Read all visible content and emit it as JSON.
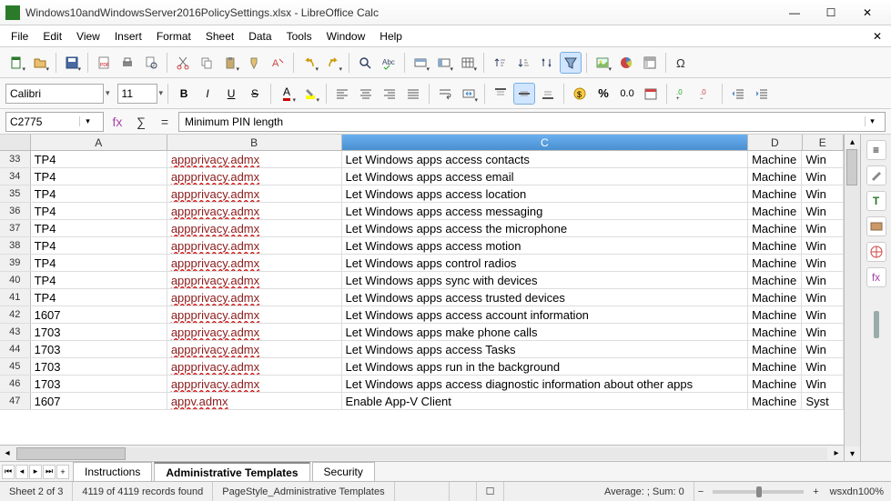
{
  "window": {
    "title": "Windows10andWindowsServer2016PolicySettings.xlsx - LibreOffice Calc",
    "min": "—",
    "max": "☐",
    "close": "✕"
  },
  "menu": [
    "File",
    "Edit",
    "View",
    "Insert",
    "Format",
    "Sheet",
    "Data",
    "Tools",
    "Window",
    "Help"
  ],
  "formatbar": {
    "font": "Calibri",
    "size": "11"
  },
  "formula": {
    "cellref": "C2775",
    "value": "Minimum PIN length"
  },
  "columns": [
    "A",
    "B",
    "C",
    "D",
    "E"
  ],
  "selectedCol": "C",
  "rows": [
    {
      "n": "33",
      "a": "TP4",
      "b": "appprivacy.admx",
      "c": "Let Windows apps access contacts",
      "d": "Machine",
      "e": "Win"
    },
    {
      "n": "34",
      "a": "TP4",
      "b": "appprivacy.admx",
      "c": "Let Windows apps access email",
      "d": "Machine",
      "e": "Win"
    },
    {
      "n": "35",
      "a": "TP4",
      "b": "appprivacy.admx",
      "c": "Let Windows apps access location",
      "d": "Machine",
      "e": "Win"
    },
    {
      "n": "36",
      "a": "TP4",
      "b": "appprivacy.admx",
      "c": "Let Windows apps access messaging",
      "d": "Machine",
      "e": "Win"
    },
    {
      "n": "37",
      "a": "TP4",
      "b": "appprivacy.admx",
      "c": "Let Windows apps access the microphone",
      "d": "Machine",
      "e": "Win"
    },
    {
      "n": "38",
      "a": "TP4",
      "b": "appprivacy.admx",
      "c": "Let Windows apps access motion",
      "d": "Machine",
      "e": "Win"
    },
    {
      "n": "39",
      "a": "TP4",
      "b": "appprivacy.admx",
      "c": "Let Windows apps control radios",
      "d": "Machine",
      "e": "Win"
    },
    {
      "n": "40",
      "a": "TP4",
      "b": "appprivacy.admx",
      "c": "Let Windows apps sync with devices",
      "d": "Machine",
      "e": "Win"
    },
    {
      "n": "41",
      "a": "TP4",
      "b": "appprivacy.admx",
      "c": "Let Windows apps access trusted devices",
      "d": "Machine",
      "e": "Win"
    },
    {
      "n": "42",
      "a": "1607",
      "b": "appprivacy.admx",
      "c": "Let Windows apps access account information",
      "d": "Machine",
      "e": "Win"
    },
    {
      "n": "43",
      "a": "1703",
      "b": "appprivacy.admx",
      "c": "Let Windows apps make phone calls",
      "d": "Machine",
      "e": "Win"
    },
    {
      "n": "44",
      "a": "1703",
      "b": "appprivacy.admx",
      "c": "Let Windows apps access Tasks",
      "d": "Machine",
      "e": "Win"
    },
    {
      "n": "45",
      "a": "1703",
      "b": "appprivacy.admx",
      "c": "Let Windows apps run in the background",
      "d": "Machine",
      "e": "Win"
    },
    {
      "n": "46",
      "a": "1703",
      "b": "appprivacy.admx",
      "c": "Let Windows apps access diagnostic information about other apps",
      "d": "Machine",
      "e": "Win"
    },
    {
      "n": "47",
      "a": "1607",
      "b": "appv.admx",
      "c": "Enable App-V Client",
      "d": "Machine",
      "e": "Syst"
    }
  ],
  "tabs": {
    "items": [
      "Instructions",
      "Administrative Templates",
      "Security"
    ],
    "active": 1
  },
  "status": {
    "sheet": "Sheet 2 of 3",
    "records": "4119 of 4119 records found",
    "pagestyle": "PageStyle_Administrative Templates",
    "lang": "",
    "calc": "Average: ; Sum: 0",
    "zoom": "wsxdn100%"
  }
}
